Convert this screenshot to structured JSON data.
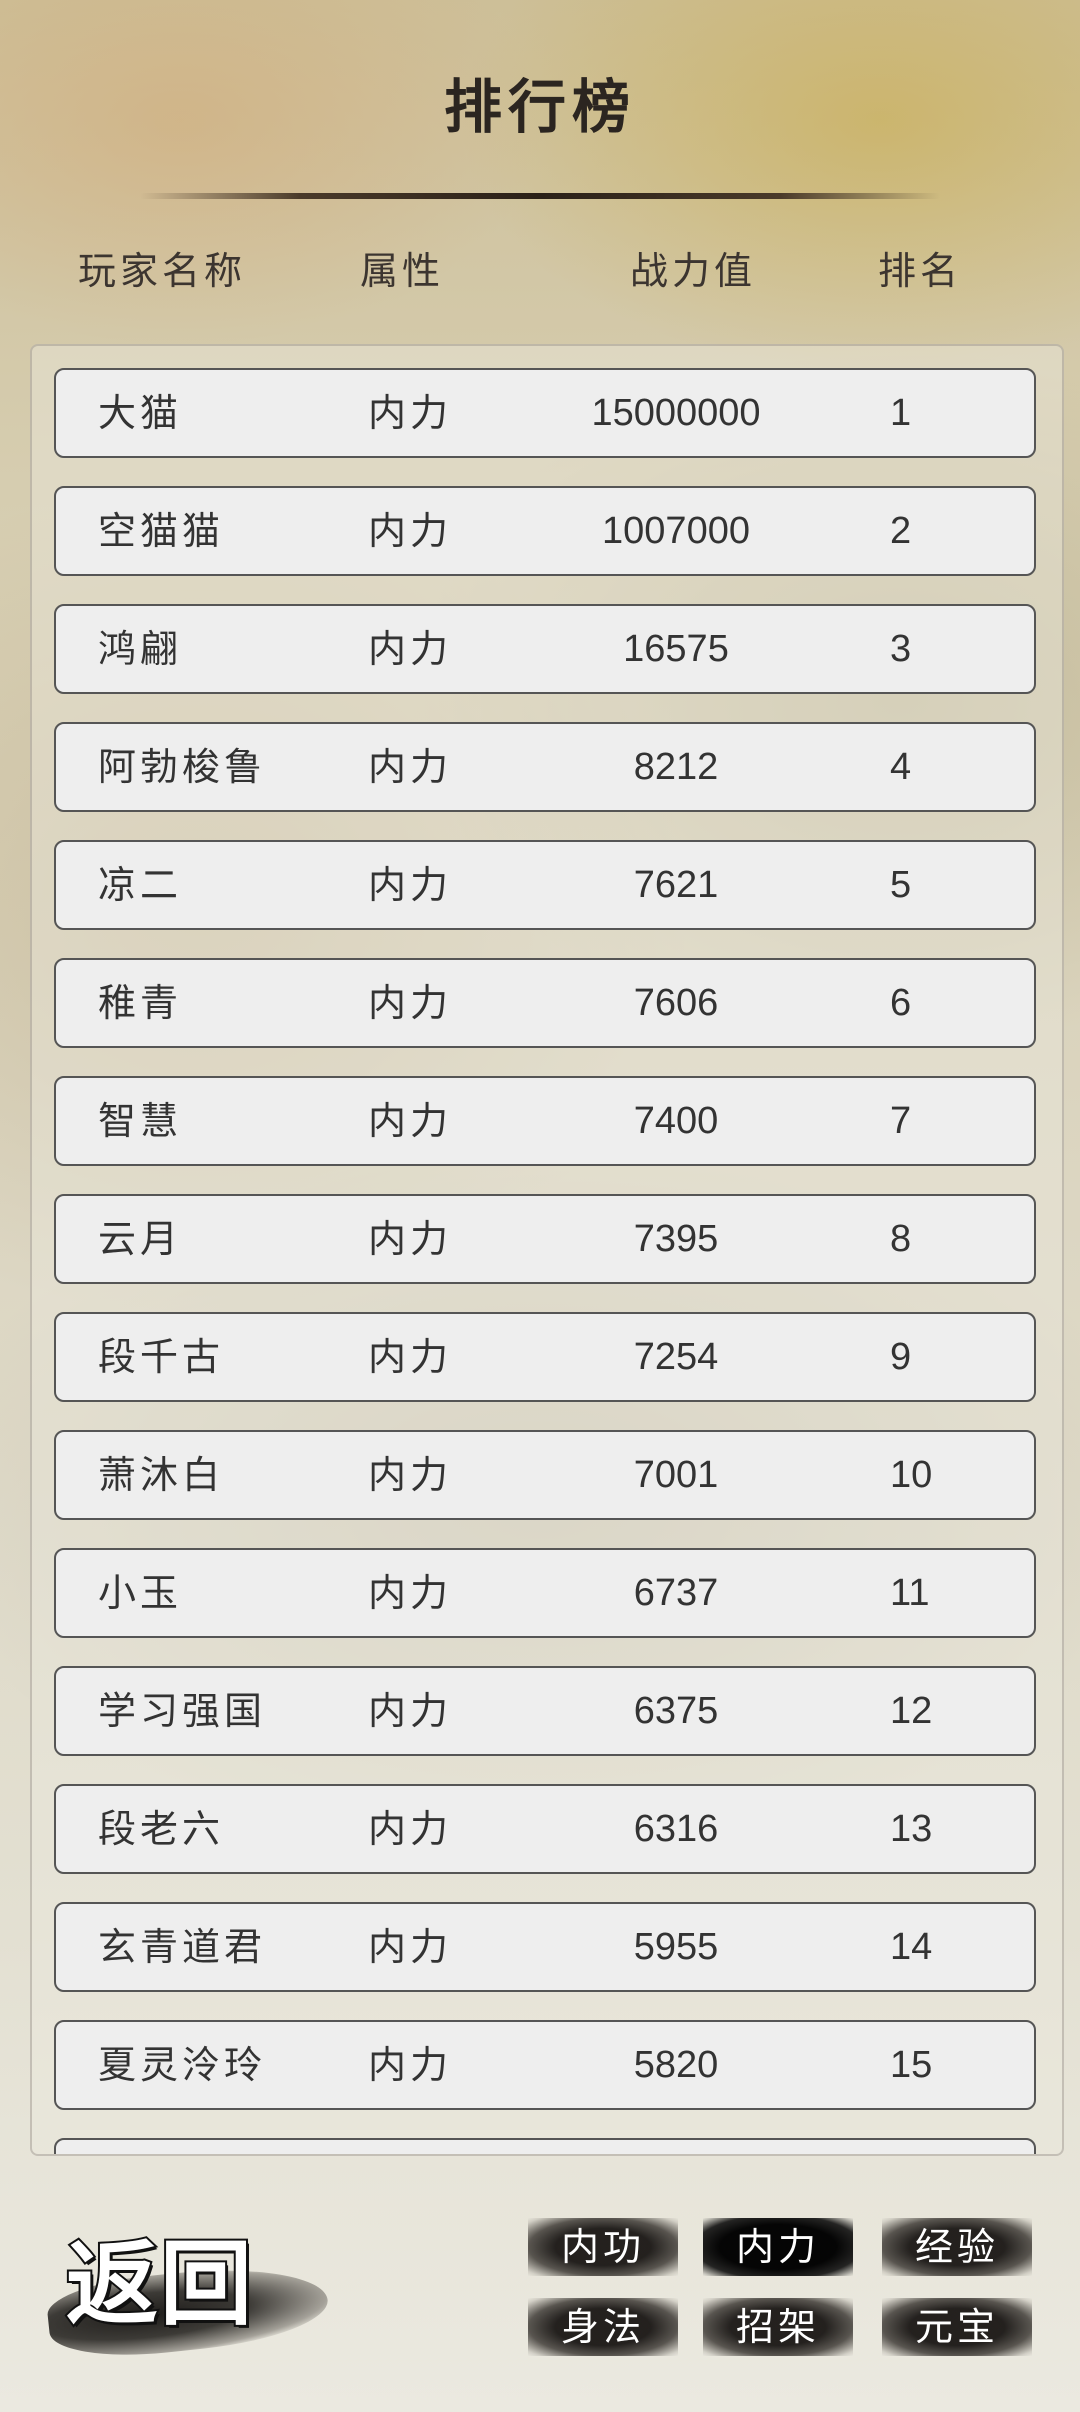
{
  "title": "排行榜",
  "headers": {
    "name": "玩家名称",
    "attribute": "属性",
    "power": "战力值",
    "rank": "排名"
  },
  "rows": [
    {
      "name": "大猫",
      "attribute": "内力",
      "power": "15000000",
      "rank": "1"
    },
    {
      "name": "空猫猫",
      "attribute": "内力",
      "power": "1007000",
      "rank": "2"
    },
    {
      "name": "鸿翩",
      "attribute": "内力",
      "power": "16575",
      "rank": "3"
    },
    {
      "name": "阿勃梭鲁",
      "attribute": "内力",
      "power": "8212",
      "rank": "4"
    },
    {
      "name": "凉二",
      "attribute": "内力",
      "power": "7621",
      "rank": "5"
    },
    {
      "name": "稚青",
      "attribute": "内力",
      "power": "7606",
      "rank": "6"
    },
    {
      "name": "智慧",
      "attribute": "内力",
      "power": "7400",
      "rank": "7"
    },
    {
      "name": "云月",
      "attribute": "内力",
      "power": "7395",
      "rank": "8"
    },
    {
      "name": "段千古",
      "attribute": "内力",
      "power": "7254",
      "rank": "9"
    },
    {
      "name": "萧沐白",
      "attribute": "内力",
      "power": "7001",
      "rank": "10"
    },
    {
      "name": "小玉",
      "attribute": "内力",
      "power": "6737",
      "rank": "11"
    },
    {
      "name": "学习强国",
      "attribute": "内力",
      "power": "6375",
      "rank": "12"
    },
    {
      "name": "段老六",
      "attribute": "内力",
      "power": "6316",
      "rank": "13"
    },
    {
      "name": "玄青道君",
      "attribute": "内力",
      "power": "5955",
      "rank": "14"
    },
    {
      "name": "夏灵泠玲",
      "attribute": "内力",
      "power": "5820",
      "rank": "15"
    }
  ],
  "back_label": "返回",
  "tabs": [
    {
      "label": "内功",
      "active": false
    },
    {
      "label": "内力",
      "active": true
    },
    {
      "label": "经验",
      "active": false
    },
    {
      "label": "身法",
      "active": false
    },
    {
      "label": "招架",
      "active": false
    },
    {
      "label": "元宝",
      "active": false
    }
  ],
  "colors": {
    "row_bg": "#eeeeee",
    "row_border": "#555555",
    "text": "#333333",
    "tab_bg": "#151311"
  }
}
